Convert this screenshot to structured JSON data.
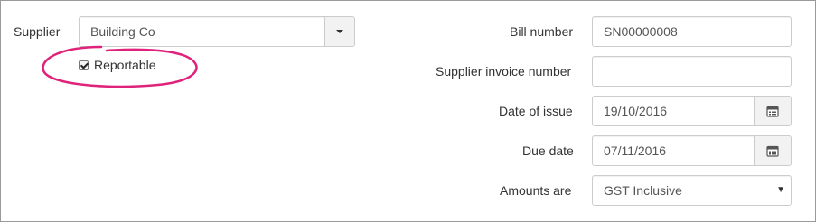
{
  "supplier": {
    "label": "Supplier",
    "value": "Building Co",
    "reportable_label": "Reportable",
    "reportable_checked": true
  },
  "bill_number": {
    "label": "Bill number",
    "value": "SN00000008"
  },
  "supplier_invoice_number": {
    "label": "Supplier invoice number",
    "value": ""
  },
  "date_of_issue": {
    "label": "Date of issue",
    "value": "19/10/2016"
  },
  "due_date": {
    "label": "Due date",
    "value": "07/11/2016"
  },
  "amounts_are": {
    "label": "Amounts are",
    "value": "GST Inclusive"
  },
  "colors": {
    "highlight": "#e0237a",
    "accent": "#333333"
  },
  "icons": {
    "dropdown": "caret-down-icon",
    "calendar": "calendar-icon"
  }
}
